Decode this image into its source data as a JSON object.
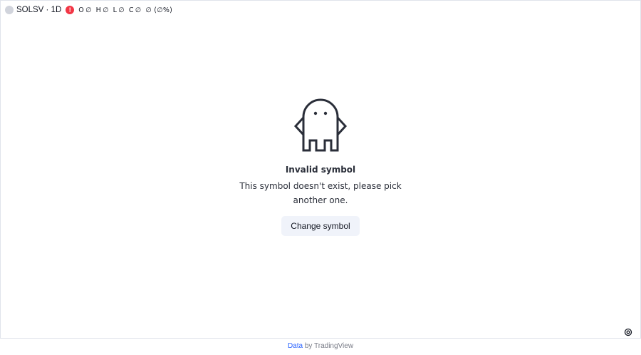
{
  "legend": {
    "symbol_title": "SOLSV · 1D",
    "alert_glyph": "!",
    "ohlc": [
      {
        "key": "O",
        "value": "∅"
      },
      {
        "key": "H",
        "value": "∅"
      },
      {
        "key": "L",
        "value": "∅"
      },
      {
        "key": "C",
        "value": "∅"
      },
      {
        "key": "",
        "value": "∅ (∅%)"
      }
    ]
  },
  "error": {
    "title": "Invalid symbol",
    "message": "This symbol doesn't exist, please pick another one.",
    "button_label": "Change symbol"
  },
  "footer": {
    "link_text": "Data",
    "suffix": " by TradingView"
  },
  "colors": {
    "alert": "#f23645",
    "link": "#2962ff",
    "button_bg": "#f0f3fa"
  },
  "icons": {
    "empty_state": "ghost-icon",
    "settings": "gear-icon"
  }
}
